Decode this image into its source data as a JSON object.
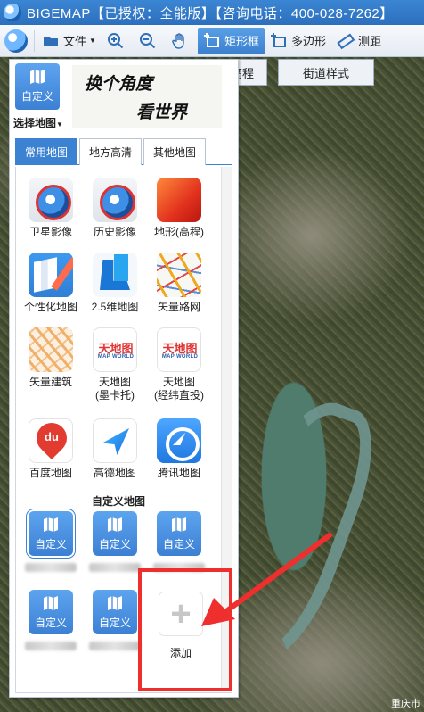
{
  "titlebar": {
    "text": "BIGEMAP【已授权：全能版】【咨询电话：400-028-7262】"
  },
  "toolbar": {
    "file_label": "文件",
    "rect_label": "矩形框",
    "polygon_label": "多边形",
    "measure_label": "测距"
  },
  "map_buttons": {
    "elevation": "高程",
    "street_style": "街道样式"
  },
  "map_label": "重庆市",
  "panel": {
    "custom_label": "自定义",
    "choose_label": "选择地图",
    "slogan": [
      "换个角度",
      "看世界"
    ],
    "tabs": [
      {
        "label": "常用地图",
        "active": true
      },
      {
        "label": "地方高清",
        "active": false
      },
      {
        "label": "其他地图",
        "active": false
      }
    ],
    "maps": [
      {
        "label": "卫星影像",
        "icon": "google-earth-icon"
      },
      {
        "label": "历史影像",
        "icon": "google-earth-history-icon"
      },
      {
        "label": "地形(高程)",
        "icon": "terrain-icon"
      },
      {
        "label": "个性化地图",
        "icon": "custom-style-map-icon"
      },
      {
        "label": "2.5维地图",
        "icon": "map-25d-icon"
      },
      {
        "label": "矢量路网",
        "icon": "vector-road-icon"
      },
      {
        "label": "矢量建筑",
        "icon": "vector-building-icon"
      },
      {
        "label": "天地图\n(墨卡托)",
        "icon": "tianditu-mercator-icon"
      },
      {
        "label": "天地图\n(经纬直投)",
        "icon": "tianditu-latlon-icon"
      },
      {
        "label": "百度地图",
        "icon": "baidu-map-icon"
      },
      {
        "label": "高德地图",
        "icon": "gaode-map-icon"
      },
      {
        "label": "腾讯地图",
        "icon": "tencent-map-icon"
      }
    ],
    "tianditu_text": "天地图",
    "tianditu_sub": "MAP WORLD",
    "baidu_text": "du",
    "custom_section_title": "自定义地图",
    "custom_items": [
      "自定义",
      "自定义",
      "自定义",
      "自定义",
      "自定义"
    ],
    "add_label": "添加",
    "add_symbol": "+"
  },
  "colors": {
    "accent": "#3b82d2",
    "highlight_box": "#ef2e2e"
  }
}
